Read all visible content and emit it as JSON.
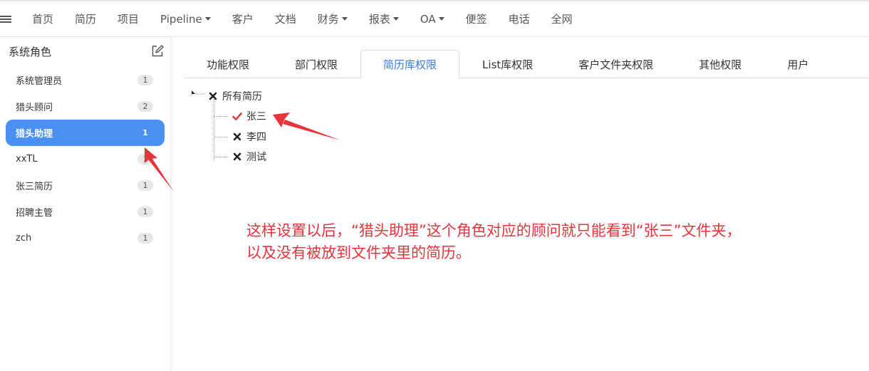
{
  "topnav": {
    "items": [
      {
        "label": "首页",
        "dropdown": false
      },
      {
        "label": "简历",
        "dropdown": false
      },
      {
        "label": "项目",
        "dropdown": false
      },
      {
        "label": "Pipeline",
        "dropdown": true
      },
      {
        "label": "客户",
        "dropdown": false
      },
      {
        "label": "文档",
        "dropdown": false
      },
      {
        "label": "财务",
        "dropdown": true
      },
      {
        "label": "报表",
        "dropdown": true
      },
      {
        "label": "OA",
        "dropdown": true
      },
      {
        "label": "便签",
        "dropdown": false
      },
      {
        "label": "电话",
        "dropdown": false
      },
      {
        "label": "全网",
        "dropdown": false
      }
    ]
  },
  "sidebar": {
    "title": "系统角色",
    "roles": [
      {
        "name": "系统管理员",
        "count": "1"
      },
      {
        "name": "猎头顾问",
        "count": "2"
      },
      {
        "name": "猎头助理",
        "count": "1",
        "active": true
      },
      {
        "name": "xxTL",
        "count": "1"
      },
      {
        "name": "张三简历",
        "count": "1"
      },
      {
        "name": "招聘主管",
        "count": "1"
      },
      {
        "name": "zch",
        "count": "1"
      }
    ]
  },
  "tabs": [
    {
      "label": "功能权限"
    },
    {
      "label": "部门权限"
    },
    {
      "label": "简历库权限",
      "active": true
    },
    {
      "label": "List库权限"
    },
    {
      "label": "客户文件夹权限"
    },
    {
      "label": "其他权限"
    },
    {
      "label": "用户"
    }
  ],
  "tree": {
    "root": {
      "label": "所有简历",
      "state": "unchecked"
    },
    "children": [
      {
        "label": "张三",
        "state": "checked"
      },
      {
        "label": "李四",
        "state": "unchecked"
      },
      {
        "label": "测试",
        "state": "unchecked"
      }
    ]
  },
  "annotation": {
    "line1": "这样设置以后，“猎头助理”这个角色对应的顾问就只能看到“张三”文件夹，",
    "line2": "以及没有被放到文件夹里的简历。"
  },
  "colors": {
    "accent": "#4a90f0",
    "tab_active": "#3a7bd5",
    "check": "#e8333a",
    "annotation": "#e8333a"
  }
}
